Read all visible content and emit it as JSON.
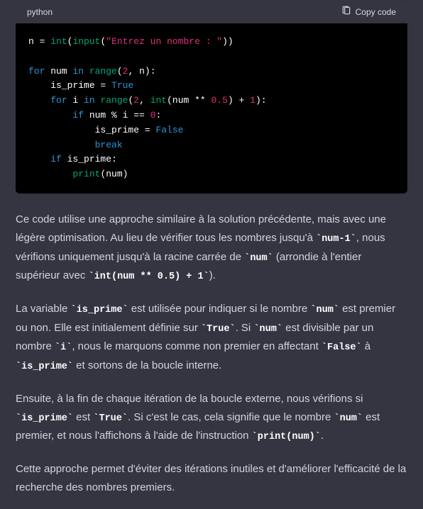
{
  "code_header": {
    "lang": "python",
    "copy_label": "Copy code"
  },
  "code": {
    "l1_var": "n = ",
    "l1_fn1": "int",
    "l1_p1": "(",
    "l1_fn2": "input",
    "l1_p2": "(",
    "l1_str": "\"Entrez un nombre : \"",
    "l1_p3": "))",
    "l3_kw1": "for",
    "l3_var1": " num ",
    "l3_kw2": "in",
    "l3_sp": " ",
    "l3_fn": "range",
    "l3_p1": "(",
    "l3_n1": "2",
    "l3_c": ", n):",
    "l4_var": "    is_prime = ",
    "l4_bool": "True",
    "l5_ind": "    ",
    "l5_kw1": "for",
    "l5_var1": " i ",
    "l5_kw2": "in",
    "l5_sp": " ",
    "l5_fn1": "range",
    "l5_p1": "(",
    "l5_n1": "2",
    "l5_c1": ", ",
    "l5_fn2": "int",
    "l5_p2": "(num ** ",
    "l5_n2": "0.5",
    "l5_p3": ") + ",
    "l5_n3": "1",
    "l5_p4": "):",
    "l6_ind": "        ",
    "l6_kw": "if",
    "l6_expr": " num % i == ",
    "l6_n": "0",
    "l6_c": ":",
    "l7_var": "            is_prime = ",
    "l7_bool": "False",
    "l8_ind": "            ",
    "l8_kw": "break",
    "l9_ind": "    ",
    "l9_kw": "if",
    "l9_var": " is_prime:",
    "l10_ind": "        ",
    "l10_fn": "print",
    "l10_p": "(num)"
  },
  "prose": {
    "p1a": "Ce code utilise une approche similaire à la solution précédente, mais avec une légère optimisation. Au lieu de vérifier tous les nombres jusqu'à ",
    "p1c1": "`num-1`",
    "p1b": ", nous vérifions uniquement jusqu'à la racine carrée de ",
    "p1c2": "`num`",
    "p1c": " (arrondie à l'entier supérieur avec ",
    "p1c3": "`int(num ** 0.5) + 1`",
    "p1d": ").",
    "p2a": "La variable ",
    "p2c1": "`is_prime`",
    "p2b": " est utilisée pour indiquer si le nombre ",
    "p2c2": "`num`",
    "p2c": " est premier ou non. Elle est initialement définie sur ",
    "p2c3": "`True`",
    "p2d": ". Si ",
    "p2c4": "`num`",
    "p2e": " est divisible par un nombre ",
    "p2c5": "`i`",
    "p2f": ", nous le marquons comme non premier en affectant ",
    "p2c6": "`False`",
    "p2g": " à ",
    "p2c7": "`is_prime`",
    "p2h": " et sortons de la boucle interne.",
    "p3a": "Ensuite, à la fin de chaque itération de la boucle externe, nous vérifions si ",
    "p3c1": "`is_prime`",
    "p3b": " est ",
    "p3c2": "`True`",
    "p3c": ". Si c'est le cas, cela signifie que le nombre ",
    "p3c3": "`num`",
    "p3d": " est premier, et nous l'affichons à l'aide de l'instruction ",
    "p3c4": "`print(num)`",
    "p3e": ".",
    "p4": "Cette approche permet d'éviter des itérations inutiles et d'améliorer l'efficacité de la recherche des nombres premiers."
  }
}
